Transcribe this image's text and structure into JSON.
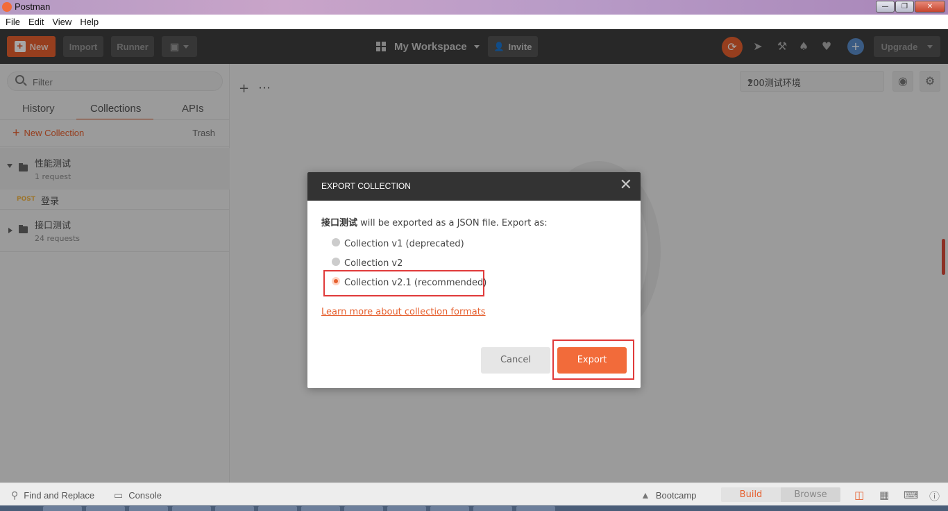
{
  "window": {
    "title": "Postman"
  },
  "menu": [
    "File",
    "Edit",
    "View",
    "Help"
  ],
  "header": {
    "new_label": "New",
    "import_label": "Import",
    "runner_label": "Runner",
    "workspace_label": "My Workspace",
    "invite_label": "Invite",
    "upgrade_label": "Upgrade"
  },
  "sidebar": {
    "filter_placeholder": "Filter",
    "tabs": [
      "History",
      "Collections",
      "APIs"
    ],
    "active_tab": "Collections",
    "new_collection_label": "New Collection",
    "trash_label": "Trash",
    "collections": [
      {
        "name": "性能测试",
        "count": "1 request",
        "expanded": true,
        "requests": [
          {
            "method": "POST",
            "name": "登录"
          }
        ]
      },
      {
        "name": "接口测试",
        "count": "24 requests",
        "expanded": false
      }
    ]
  },
  "environment": {
    "selected": "200测试环境"
  },
  "modal": {
    "title": "EXPORT COLLECTION",
    "collection_name": "接口测试",
    "intro_suffix": " will be exported as a JSON file. Export as:",
    "options": [
      "Collection v1 (deprecated)",
      "Collection v2",
      "Collection v2.1 (recommended)"
    ],
    "selected_option": "Collection v2.1 (recommended)",
    "learn_more": "Learn more about collection formats",
    "cancel_label": "Cancel",
    "export_label": "Export"
  },
  "statusbar": {
    "find_replace": "Find and Replace",
    "console": "Console",
    "bootcamp": "Bootcamp",
    "build": "Build",
    "browse": "Browse"
  },
  "colors": {
    "accent": "#f26b3a",
    "header_bg": "#3e3e3e",
    "highlight_box": "#e03a3a"
  }
}
